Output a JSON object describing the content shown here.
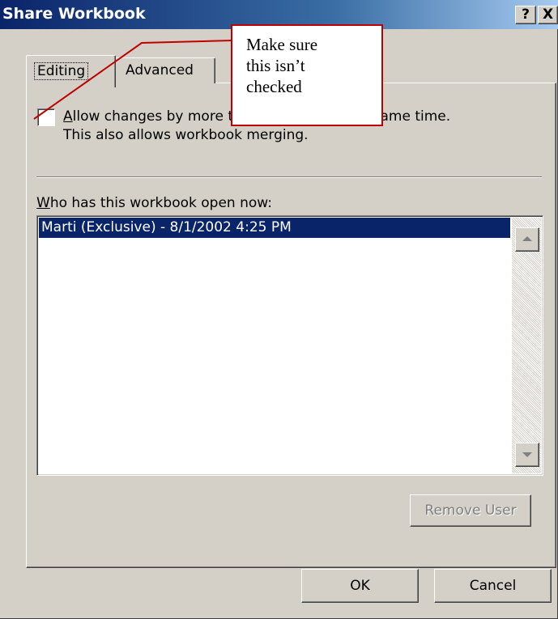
{
  "window": {
    "title": "Share Workbook",
    "help_glyph": "?",
    "close_glyph": "X"
  },
  "tabs": [
    {
      "label": "Editing",
      "selected": true
    },
    {
      "label": "Advanced",
      "selected": false
    }
  ],
  "editing": {
    "checkbox": {
      "accesskey_char": "A",
      "label_rest": "llow changes by more than one user at the same time.",
      "second_line": "This also allows workbook merging.",
      "checked": false
    },
    "users_label": {
      "accesskey_char": "W",
      "rest": "ho has this workbook open now:"
    },
    "users": [
      {
        "text": "Marti (Exclusive) - 8/1/2002 4:25 PM",
        "selected": true
      }
    ],
    "remove_button": "Remove User"
  },
  "buttons": {
    "ok": "OK",
    "cancel": "Cancel"
  },
  "callout": {
    "line1": "Make sure",
    "line2": "this isn’t",
    "line3": "checked",
    "border_color": "#c00000"
  },
  "colors": {
    "title_bar": "#0a246a",
    "dialog_face": "#d4d0c8",
    "selection": "#0a246a"
  }
}
